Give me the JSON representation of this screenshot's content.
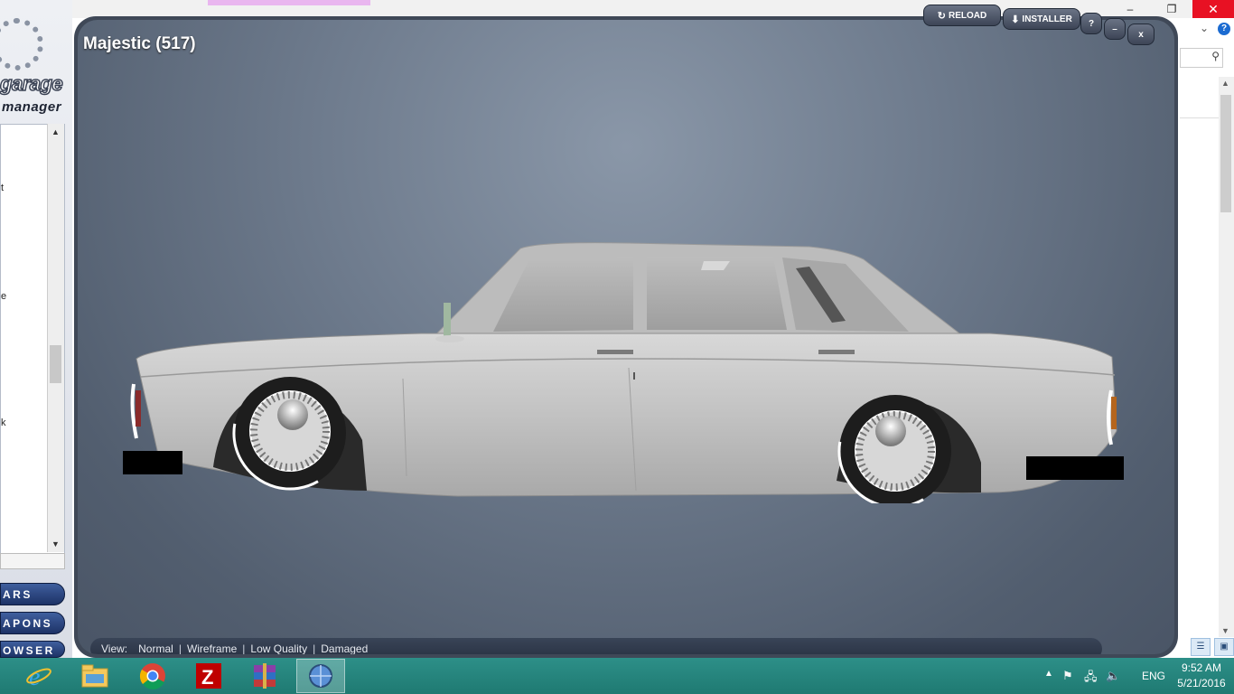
{
  "header": {
    "reload_label": "RELOAD",
    "installer_label": "INSTALLER",
    "help_label": "?",
    "minimize_label": "–",
    "close_label": "x"
  },
  "logo": {
    "line1": "garage",
    "line2": "manager"
  },
  "vehicle_list": {
    "items": [
      "t",
      "e",
      "k"
    ]
  },
  "nav": {
    "cars": "ARS",
    "weapons": "APONS",
    "browser": "OWSER"
  },
  "viewer": {
    "title": "Majestic (517)",
    "view_label": "View:",
    "view_options": [
      "Normal",
      "Wireframe",
      "Low Quality",
      "Damaged"
    ]
  },
  "browser_bg": {
    "window_minimize": "–",
    "window_restore": "❐",
    "window_close": "✕",
    "help": "?"
  },
  "taskbar": {
    "apps": [
      "internet-explorer",
      "file-explorer",
      "chrome",
      "filezilla",
      "winrar",
      "garage-manager"
    ],
    "language": "ENG",
    "time": "9:52 AM",
    "date": "5/21/2016"
  },
  "colors": {
    "viewer_bg": "#6e7b8d",
    "taskbar": "#2d8f88",
    "nav_button": "#2a4580",
    "car_body": "#c9c9c9"
  }
}
